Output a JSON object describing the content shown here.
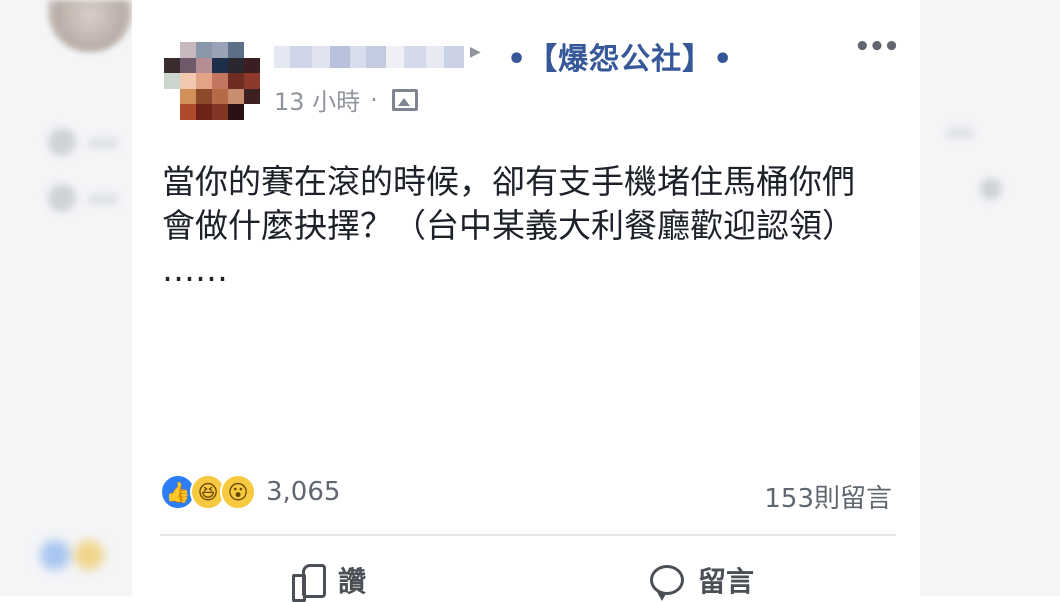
{
  "post": {
    "page_name": "•【爆怨公社】•",
    "time": "13 小時",
    "separator": "·",
    "privacy_icon": "photo-icon",
    "more_icon": "more-icon",
    "more_label": "•••",
    "text_lines": [
      "當你的賽在滾的時候，卻有支手機堵住馬桶你們",
      "會做什麼抉擇？（台中某義大利餐廳歡迎認領）",
      "……"
    ]
  },
  "reactions": {
    "icons": [
      "like-reaction-icon",
      "haha-reaction-icon",
      "wow-reaction-icon"
    ],
    "count": "3,065"
  },
  "comments": {
    "count_label": "153則留言"
  },
  "actions": {
    "like_label": "讚",
    "comment_label": "留言"
  },
  "colors": {
    "page_name": "#365899",
    "meta_text": "#90949c",
    "like_blue": "#2d7df6",
    "emoji_yellow": "#f7c940"
  }
}
